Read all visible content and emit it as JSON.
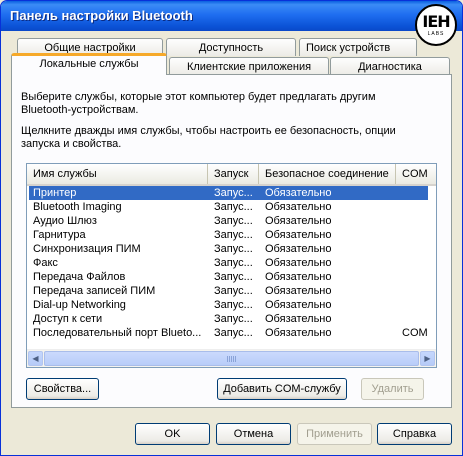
{
  "window": {
    "title": "Панель настройки Bluetooth"
  },
  "logo": {
    "main": "IEH",
    "sub": "LABS"
  },
  "tabs_back": [
    "Общие настройки",
    "Доступность",
    "Поиск устройств"
  ],
  "tabs_front": [
    "Локальные службы",
    "Клиентские приложения",
    "Диагностика"
  ],
  "active_tab": "Локальные службы",
  "description": {
    "line1": "Выберите службы, которые этот компьютер будет предлагать другим",
    "line2": "Bluetooth-устройствам.",
    "line3": "Щелкните дважды имя службы, чтобы настроить ее безопасность, опции",
    "line4": "запуска и свойства."
  },
  "services_table": {
    "columns": [
      "Имя службы",
      "Запуск",
      "Безопасное соединение",
      "COM"
    ],
    "rows": [
      {
        "name": "Принтер",
        "start": "Запус...",
        "secure": "Обязательно",
        "com": "",
        "selected": true
      },
      {
        "name": "Bluetooth Imaging",
        "start": "Запус...",
        "secure": "Обязательно",
        "com": ""
      },
      {
        "name": "Аудио Шлюз",
        "start": "Запус...",
        "secure": "Обязательно",
        "com": ""
      },
      {
        "name": "Гарнитура",
        "start": "Запус...",
        "secure": "Обязательно",
        "com": ""
      },
      {
        "name": "Синхронизация ПИМ",
        "start": "Запус...",
        "secure": "Обязательно",
        "com": ""
      },
      {
        "name": "Факс",
        "start": "Запус...",
        "secure": "Обязательно",
        "com": ""
      },
      {
        "name": "Передача Файлов",
        "start": "Запус...",
        "secure": "Обязательно",
        "com": ""
      },
      {
        "name": "Передача записей ПИМ",
        "start": "Запус...",
        "secure": "Обязательно",
        "com": ""
      },
      {
        "name": "Dial-up Networking",
        "start": "Запус...",
        "secure": "Обязательно",
        "com": ""
      },
      {
        "name": "Доступ к сети",
        "start": "Запус...",
        "secure": "Обязательно",
        "com": ""
      },
      {
        "name": "Последовательный порт Blueto...",
        "start": "Запус...",
        "secure": "Обязательно",
        "com": "COM"
      }
    ]
  },
  "panel_buttons": {
    "properties": "Свойства...",
    "add_com": "Добавить COM-службу",
    "delete": "Удалить"
  },
  "dialog_buttons": {
    "ok": "OK",
    "cancel": "Отмена",
    "apply": "Применить",
    "help": "Справка"
  },
  "colors": {
    "titlebar": "#0a5fe0",
    "selection": "#316ac5",
    "tab_accent": "#f6a92a"
  }
}
